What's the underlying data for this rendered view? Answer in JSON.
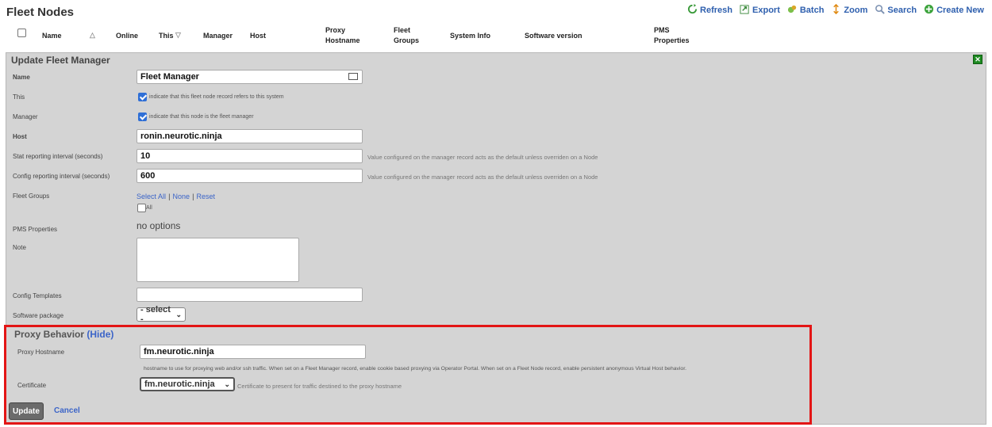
{
  "page": {
    "title": "Fleet Nodes"
  },
  "toolbar": [
    {
      "label": "Refresh",
      "icon": "refresh-icon"
    },
    {
      "label": "Export",
      "icon": "export-icon"
    },
    {
      "label": "Batch",
      "icon": "batch-icon"
    },
    {
      "label": "Zoom",
      "icon": "zoom-icon"
    },
    {
      "label": "Search",
      "icon": "search-icon"
    },
    {
      "label": "Create New",
      "icon": "create-icon"
    }
  ],
  "columns": {
    "name": "Name",
    "online": "Online",
    "this": "This",
    "manager": "Manager",
    "host": "Host",
    "proxy_hostname_1": "Proxy",
    "proxy_hostname_2": "Hostname",
    "fleet_groups_1": "Fleet",
    "fleet_groups_2": "Groups",
    "system_info": "System Info",
    "software_version": "Software version",
    "pms_1": "PMS",
    "pms_2": "Properties"
  },
  "form": {
    "title": "Update Fleet Manager",
    "name_label": "Name",
    "name_value": "Fleet Manager",
    "this_label": "This",
    "this_text": "indicate that this fleet node record refers to this system",
    "manager_label": "Manager",
    "manager_text": "indicate that this node is the fleet manager",
    "host_label": "Host",
    "host_value": "ronin.neurotic.ninja",
    "stat_label": "Stat reporting interval (seconds)",
    "stat_value": "10",
    "stat_help": "Value configured on the manager record acts as the default unless overriden on a Node",
    "config_label": "Config reporting interval (seconds)",
    "config_value": "600",
    "config_help": "Value configured on the manager record acts as the default unless overriden on a Node",
    "fleet_groups_label": "Fleet Groups",
    "select_all": "Select All",
    "none": "None",
    "reset": "Reset",
    "sep": "|",
    "all_option": "All",
    "pms_label": "PMS Properties",
    "pms_value": "no options",
    "note_label": "Note",
    "config_templates_label": "Config Templates",
    "software_package_label": "Software package",
    "software_package_value": "- select -"
  },
  "proxy": {
    "title": "Proxy Behavior",
    "hide": "(Hide)",
    "hostname_label": "Proxy Hostname",
    "hostname_value": "fm.neurotic.ninja",
    "hostname_help": "hostname to use for proxying web and/or ssh traffic. When set on a Fleet Manager record, enable cookie based proxying via Operator Portal. When set on a Fleet Node record, enable persistent anonymous Virtual Host behavior.",
    "cert_label": "Certificate",
    "cert_value": "fm.neurotic.ninja",
    "cert_help": "Certificate to present for traffic destined to the proxy hostname"
  },
  "actions": {
    "update": "Update",
    "cancel": "Cancel"
  },
  "colors": {
    "panel": "#d4d4d4",
    "link": "#3b64c8",
    "highlight": "#e31515"
  }
}
